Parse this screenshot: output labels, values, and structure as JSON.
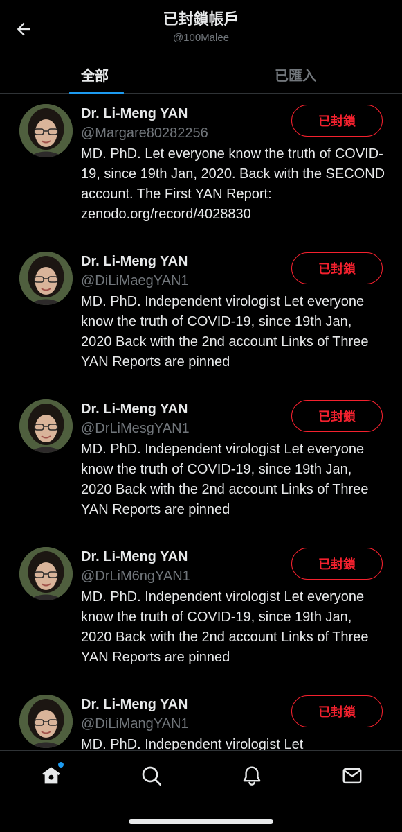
{
  "header": {
    "title": "已封鎖帳戶",
    "subtitle": "@100Malee"
  },
  "tabs": [
    {
      "label": "全部",
      "active": true
    },
    {
      "label": "已匯入",
      "active": false
    }
  ],
  "accounts": [
    {
      "name": "Dr. Li-Meng YAN",
      "handle": "@Margare80282256",
      "bio": "MD. PhD. Let everyone know the truth of COVID-19, since 19th Jan, 2020. Back with the SECOND account. The First YAN Report: zenodo.org/record/4028830",
      "button": "已封鎖"
    },
    {
      "name": "Dr. Li-Meng YAN",
      "handle": "@DiLiMaegYAN1",
      "bio": "MD. PhD. Independent virologist Let everyone know the truth of COVID-19, since 19th Jan, 2020 Back with the 2nd account Links of Three YAN Reports are pinned",
      "button": "已封鎖"
    },
    {
      "name": "Dr. Li-Meng YAN",
      "handle": "@DrLiMesgYAN1",
      "bio": "MD. PhD. Independent virologist Let everyone know the truth of COVID-19, since 19th Jan, 2020 Back with the 2nd account Links of Three YAN Reports are pinned",
      "button": "已封鎖"
    },
    {
      "name": "Dr. Li-Meng YAN",
      "handle": "@DrLiM6ngYAN1",
      "bio": "MD. PhD. Independent virologist Let everyone know the truth of COVID-19, since 19th Jan, 2020 Back with the 2nd account Links of Three YAN Reports are pinned",
      "button": "已封鎖"
    },
    {
      "name": "Dr. Li-Meng YAN",
      "handle": "@DiLiMangYAN1",
      "bio": "MD. PhD. Independent virologist Let",
      "button": "已封鎖"
    }
  ],
  "bottom_nav": [
    {
      "icon": "home-icon",
      "notification": true
    },
    {
      "icon": "search-icon",
      "notification": false
    },
    {
      "icon": "bell-icon",
      "notification": false
    },
    {
      "icon": "mail-icon",
      "notification": false
    }
  ],
  "colors": {
    "background": "#000000",
    "text": "#e7e9ea",
    "muted": "#71767b",
    "accent": "#1d9bf0",
    "blocked": "#f4212e"
  }
}
